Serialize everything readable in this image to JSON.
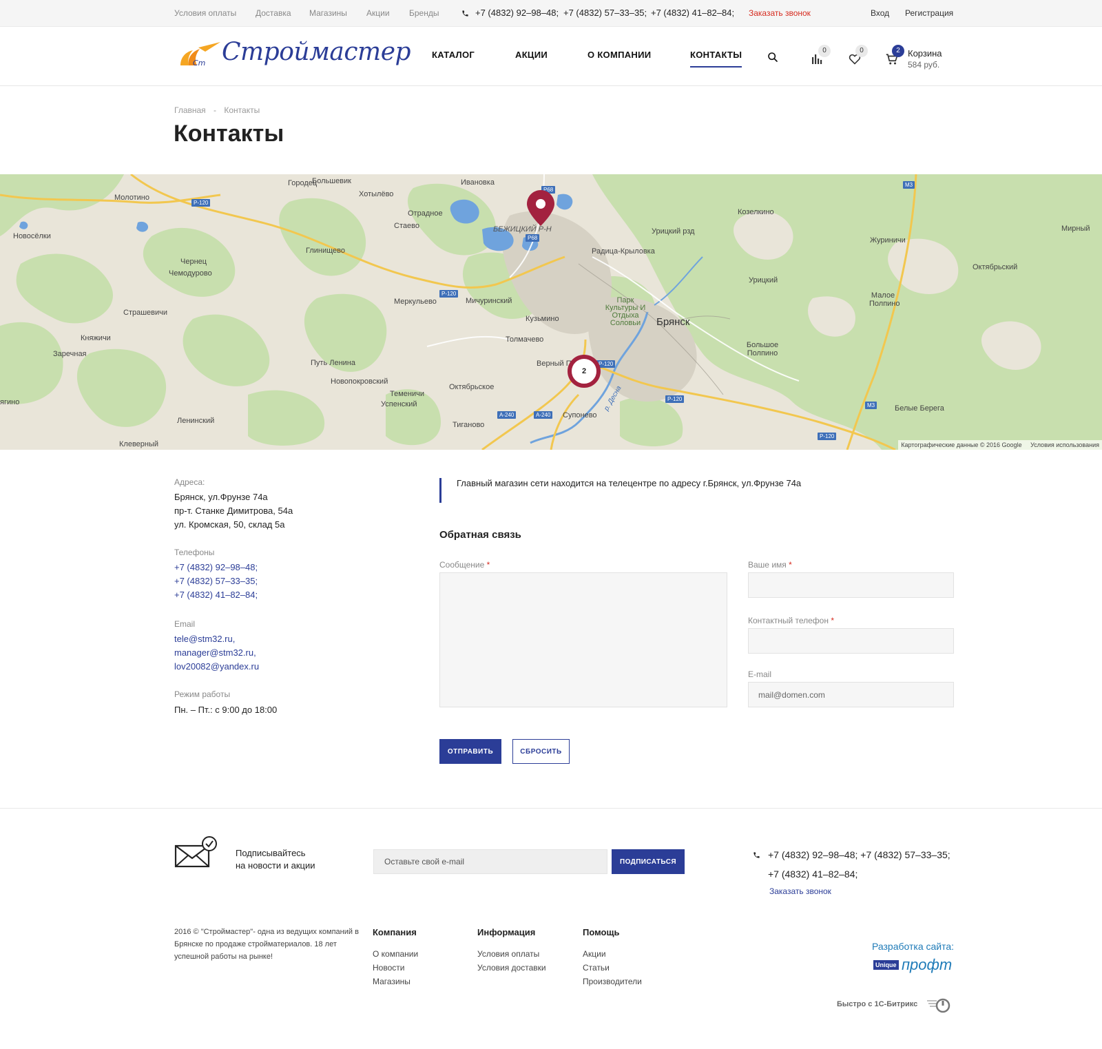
{
  "topbar": {
    "links": [
      "Условия оплаты",
      "Доставка",
      "Магазины",
      "Акции",
      "Бренды"
    ],
    "phones": [
      "+7 (4832) 92–98–48;",
      "+7 (4832) 57–33–35;",
      "+7 (4832) 41–82–84;"
    ],
    "callback": "Заказать звонок",
    "login": "Вход",
    "register": "Регистрация"
  },
  "header": {
    "logo_mark": "Cm",
    "logo_text": "Строймастер",
    "nav": [
      "КАТАЛОГ",
      "АКЦИИ",
      "О КОМПАНИИ",
      "КОНТАКТЫ"
    ],
    "compare_count": "0",
    "favorites_count": "0",
    "cart_count": "2",
    "cart_label": "Корзина",
    "cart_total": "584 руб."
  },
  "breadcrumb": {
    "home": "Главная",
    "separator": "-",
    "current": "Контакты"
  },
  "page_title": "Контакты",
  "map": {
    "cluster_count": "2",
    "copyright": "Картографические данные © 2016 Google",
    "terms": "Условия использования",
    "labels": {
      "gorodets": "Городец",
      "bolshevik": "Большевик",
      "ivanovka": "Ивановка",
      "molotino": "Молотино",
      "khotylevo": "Хотылёво",
      "otradnoe": "Отрадное",
      "staevo": "Стаево",
      "bezhitsky": "БЕЖИЦКИЙ Р-Н",
      "kozelkino": "Козелкино",
      "uritsky_rzd": "Урицкий рзд",
      "mirny": "Мирный",
      "novoselki": "Новосёлки",
      "glinishchevo": "Глинищево",
      "raditsa": "Радица-Крыловка",
      "zhurinichi": "Журиничи",
      "oktyabrsky": "Октябрьский",
      "chernets": "Чернец",
      "chemodurovo": "Чемодурово",
      "uritsky": "Урицкий",
      "maloe_polpino": "Малое Полпино",
      "merkulevo": "Меркульево",
      "michurinsky": "Мичуринский",
      "park": "Парк Культуры И Отдыха Соловьи",
      "strashevichi": "Страшевичи",
      "kuzmino": "Кузьмино",
      "bryansk": "Брянск",
      "knyazhichi": "Княжичи",
      "tolmachevo": "Толмачево",
      "zarechnaya": "Заречная",
      "bolshoe_polpino": "Большое Полпино",
      "put_lenina": "Путь Ленина",
      "verny_put": "Верный П",
      "novopokrovsky": "Новопокровский",
      "oktyabrskoe": "Октябрьское",
      "temenichi": "Теменичи",
      "uspensky": "Успенский",
      "suponevo": "Супонево",
      "belye_berega": "Белые Берега",
      "lagino": "ягино",
      "leninsky": "Ленинский",
      "tiganovo": "Тиганово",
      "klevernyy": "Клеверный",
      "desna": "р. Десна"
    },
    "road_signs": {
      "p120": "P-120",
      "p68": "P68",
      "m3": "M3",
      "a240": "A-240"
    }
  },
  "contacts": {
    "addresses_label": "Адреса:",
    "addresses": [
      "Брянск, ул.Фрунзе 74а",
      "пр-т. Станке Димитрова, 54а",
      "ул. Кромская, 50, склад 5а"
    ],
    "phones_label": "Телефоны",
    "phones": [
      "+7 (4832) 92–98–48;",
      "+7 (4832) 57–33–35;",
      "+7 (4832) 41–82–84;"
    ],
    "email_label": "Email",
    "emails": [
      "tele@stm32.ru,",
      "manager@stm32.ru,",
      "lov20082@yandex.ru"
    ],
    "hours_label": "Режим работы",
    "hours": "Пн. – Пт.: с 9:00 до 18:00"
  },
  "notice": "Главный магазин сети находится на телецентре по адресу г.Брянск, ул.Фрунзе 74а",
  "form": {
    "title": "Обратная связь",
    "message_label": "Сообщение",
    "name_label": "Ваше имя",
    "phone_label": "Контактный телефон",
    "email_label": "E-mail",
    "email_placeholder": "mail@domen.com",
    "required_mark": "*",
    "submit": "ОТПРАВИТЬ",
    "reset": "СБРОСИТЬ"
  },
  "footer": {
    "subscribe_line1": "Подписывайтесь",
    "subscribe_line2": "на новости и акции",
    "subscribe_placeholder": "Оставьте свой e-mail",
    "subscribe_button": "ПОДПИСАТЬСЯ",
    "phones": "+7 (4832) 92–98–48;  +7 (4832) 57–33–35;  +7 (4832) 41–82–84;",
    "callback": "Заказать звонок",
    "copyright": "2016 © \"Строймастер\"- одна из ведущих компаний в Брянске по продаже стройматериалов. 18 лет успешной работы на рынке!",
    "columns": [
      {
        "title": "Компания",
        "links": [
          "О компании",
          "Новости",
          "Магазины"
        ]
      },
      {
        "title": "Информация",
        "links": [
          "Условия оплаты",
          "Условия доставки"
        ]
      },
      {
        "title": "Помощь",
        "links": [
          "Акции",
          "Статьи",
          "Производители"
        ]
      }
    ],
    "dev_label": "Разработка сайта:",
    "dev_logo_box": "Unique",
    "dev_logo_text": "профт",
    "bitrix": "Быстро с 1С-Битрикс"
  },
  "colors": {
    "brand_blue": "#2b3d97",
    "callback_red": "#d62b1f",
    "marker_red": "#a3223f",
    "map_green": "#c8dfae",
    "map_water": "#6fa3dd",
    "map_road": "#f2c74f"
  }
}
